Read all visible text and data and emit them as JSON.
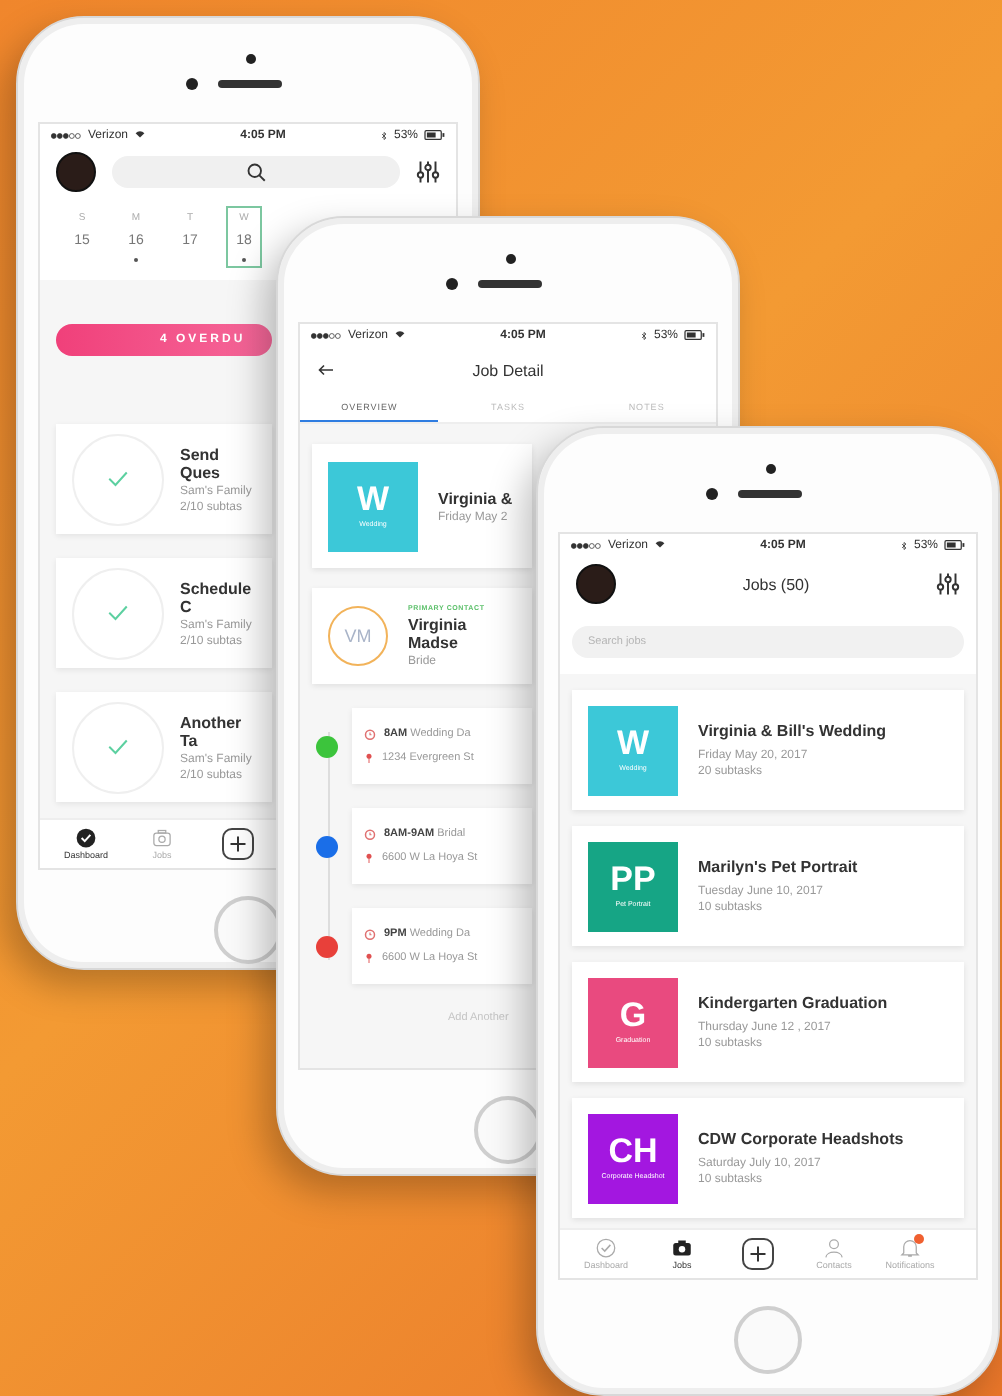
{
  "dashboard_screen": {
    "status_bar": {
      "carrier": "Verizon",
      "time": "4:05 PM",
      "battery": "53%"
    },
    "week": [
      {
        "day": "S",
        "date": "15",
        "has_events": false,
        "selected": false
      },
      {
        "day": "M",
        "date": "16",
        "has_events": true,
        "selected": false
      },
      {
        "day": "T",
        "date": "17",
        "has_events": false,
        "selected": false
      },
      {
        "day": "W",
        "date": "18",
        "has_events": true,
        "selected": true
      }
    ],
    "overdue_banner": "4 OVERDU",
    "tasks": [
      {
        "title": "Send Ques",
        "client": "Sam's Family",
        "subtasks": "2/10 subtas",
        "done": true
      },
      {
        "title": "Schedule C",
        "client": "Sam's Family",
        "subtasks": "2/10 subtas",
        "done": true
      },
      {
        "title": "Another Ta",
        "client": "Sam's Family",
        "subtasks": "2/10 subtas",
        "done": true
      }
    ],
    "tab_bar": [
      {
        "kind": "dashboard",
        "label": "Dashboard",
        "selected": true
      },
      {
        "kind": "jobs",
        "label": "Jobs",
        "selected": false
      },
      {
        "kind": "add",
        "selected": false
      }
    ]
  },
  "job_detail_screen": {
    "status_bar": {
      "carrier": "Verizon",
      "time": "4:05 PM",
      "battery": "53%"
    },
    "title": "Job Detail",
    "tabs": [
      {
        "label": "OVERVIEW",
        "selected": true
      },
      {
        "label": "TASKS",
        "selected": false
      },
      {
        "label": "NOTES",
        "selected": false
      }
    ],
    "job": {
      "initial": "W",
      "type": "Wedding",
      "color": "#3cc8d8",
      "name": "Virginia &",
      "date": "Friday May 2"
    },
    "contact": {
      "initials": "VM",
      "role_label": "PRIMARY CONTACT",
      "name": "Virginia Madse",
      "role": "Bride"
    },
    "events": [
      {
        "color": "#3cc43c",
        "time": "8AM",
        "title": "Wedding Da",
        "address": "1234 Evergreen St"
      },
      {
        "color": "#1a6ee8",
        "time": "8AM-9AM",
        "title": "Bridal",
        "address": "6600 W La Hoya St"
      },
      {
        "color": "#e8403a",
        "time": "9PM",
        "title": "Wedding Da",
        "address": "6600 W La Hoya St"
      }
    ],
    "add_event": "Add Another"
  },
  "jobs_screen": {
    "status_bar": {
      "carrier": "Verizon",
      "time": "4:05 PM",
      "battery": "53%"
    },
    "title": "Jobs (50)",
    "search": {
      "placeholder": "Search jobs"
    },
    "jobs": [
      {
        "initial": "W",
        "type": "Wedding",
        "color": "#3cc8d8",
        "name": "Virginia & Bill's Wedding",
        "date": "Friday May 20, 2017",
        "subtasks": "20 subtasks"
      },
      {
        "initial": "PP",
        "type": "Pet Portrait",
        "color": "#16a585",
        "name": "Marilyn's Pet Portrait",
        "date": "Tuesday June 10, 2017",
        "subtasks": "10 subtasks"
      },
      {
        "initial": "G",
        "type": "Graduation",
        "color": "#e94a7f",
        "name": "Kindergarten Graduation",
        "date": "Thursday June 12 , 2017",
        "subtasks": "10 subtasks"
      },
      {
        "initial": "CH",
        "type": "Corporate Headshot",
        "color": "#a317e0",
        "name": "CDW Corporate Headshots",
        "date": "Saturday July 10, 2017",
        "subtasks": "10 subtasks"
      }
    ],
    "tab_bar": [
      {
        "kind": "dashboard",
        "label": "Dashboard",
        "selected": false
      },
      {
        "kind": "jobs",
        "label": "Jobs",
        "selected": true
      },
      {
        "kind": "add",
        "selected": false
      },
      {
        "kind": "contacts",
        "label": "Contacts",
        "selected": false
      },
      {
        "kind": "notifications",
        "label": "Notifications",
        "selected": false,
        "badge": true
      }
    ]
  }
}
